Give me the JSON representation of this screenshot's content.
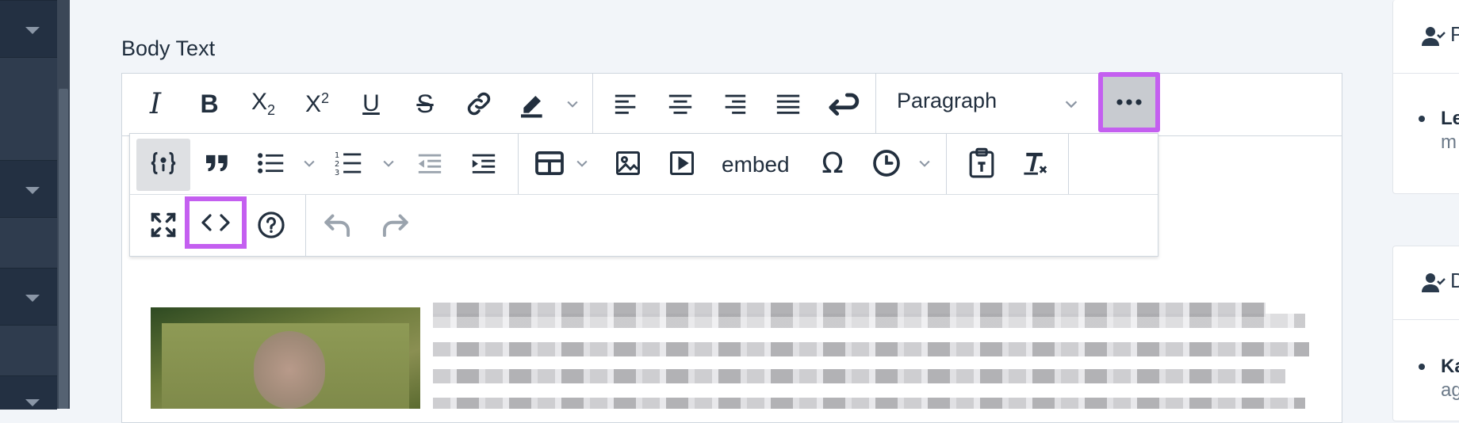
{
  "field": {
    "label": "Body Text"
  },
  "toolbar": {
    "row1": [
      {
        "name": "italic-icon",
        "glyph": "I"
      },
      {
        "name": "bold-icon",
        "glyph": "B"
      },
      {
        "name": "subscript-icon",
        "glyph": "X₂"
      },
      {
        "name": "superscript-icon",
        "glyph": "X²"
      },
      {
        "name": "underline-icon",
        "glyph": "U"
      },
      {
        "name": "strikethrough-icon",
        "glyph": "S"
      }
    ],
    "block_format": "Paragraph",
    "more_tooltip_icon": "more-icon"
  },
  "overflow": {
    "embed_label": "embed",
    "special_char_glyph": "Ω"
  },
  "right_cards": [
    {
      "title": "P",
      "line1": "Le",
      "line2": "m"
    },
    {
      "title": "D",
      "line1": "Ka",
      "line2": "ag"
    }
  ],
  "colors": {
    "highlight": "#c45ff0",
    "sidebar": "#283547"
  }
}
